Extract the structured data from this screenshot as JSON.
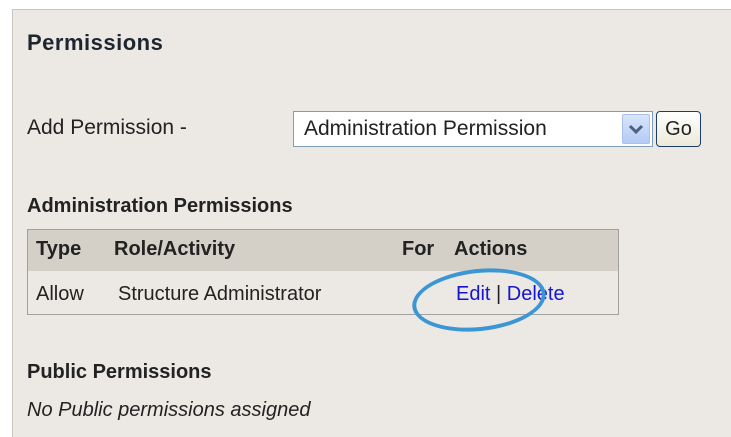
{
  "permissions": {
    "title": "Permissions",
    "add_label": "Add Permission -",
    "select": {
      "selected": "Administration Permission",
      "options": [
        "Administration Permission"
      ]
    },
    "go_label": "Go",
    "admin_section": {
      "heading": "Administration Permissions",
      "columns": [
        "Type",
        "Role/Activity",
        "For",
        "Actions"
      ],
      "rows": [
        {
          "type": "Allow",
          "role": "Structure Administrator",
          "edit_label": "Edit",
          "separator": "|",
          "delete_label": "Delete"
        }
      ]
    },
    "public_section": {
      "heading": "Public Permissions",
      "empty_text": "No Public permissions assigned"
    }
  },
  "colors": {
    "panel_background": "#ece9e4",
    "table_header_background": "#d4d0c8",
    "link": "#1515d0",
    "highlight_ring": "#3c96d4",
    "select_border": "#7f9db9"
  },
  "icons": {
    "dropdown": "chevron-down-icon"
  }
}
